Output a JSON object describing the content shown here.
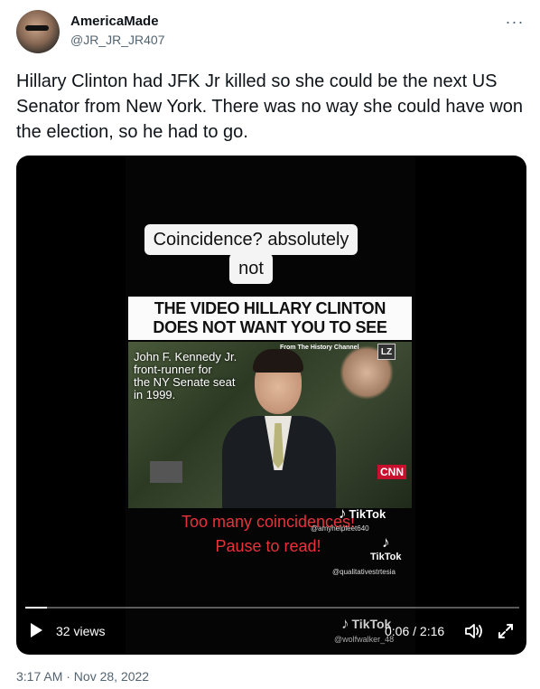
{
  "author": {
    "name": "AmericaMade",
    "handle": "@JR_JR_JR407",
    "avatar_icon": "user-avatar"
  },
  "tweet": {
    "text": "Hillary Clinton had JFK Jr killed so she could be the next US Senator from New York. There was no way she could have won the election, so he had to go.",
    "timestamp": "3:17 AM · Nov 28, 2022"
  },
  "menu": {
    "more_label": "···"
  },
  "video": {
    "caption_line1": "Coincidence? absolutely",
    "caption_line2": "not",
    "banner_line1": "THE VIDEO HILLARY CLINTON",
    "banner_line2": "DOES NOT WANT YOU TO SEE",
    "clip_source": "From The History Channel",
    "clip_info_line1": "John F. Kennedy Jr.",
    "clip_info_line2": "front-runner for",
    "clip_info_line3": "the NY Senate seat",
    "clip_info_line4": "in 1999.",
    "clip_logo_lz": "LZ",
    "clip_logo_cnn": "CNN",
    "red_caption_line1": "Too many coincidences!",
    "red_caption_line2": "Pause to read!",
    "tiktok_label": "TikTok",
    "tiktok_handle_1": "@amyhelpleet640",
    "tiktok_handle_2": "@qualitativestrtesia",
    "tiktok_handle_3": "@wolfwalker_48",
    "views": "32 views",
    "time": "0:06 / 2:16",
    "progress_fraction": 0.044
  },
  "colors": {
    "caption_red": "#e8323a",
    "handle_gray": "#536471"
  }
}
